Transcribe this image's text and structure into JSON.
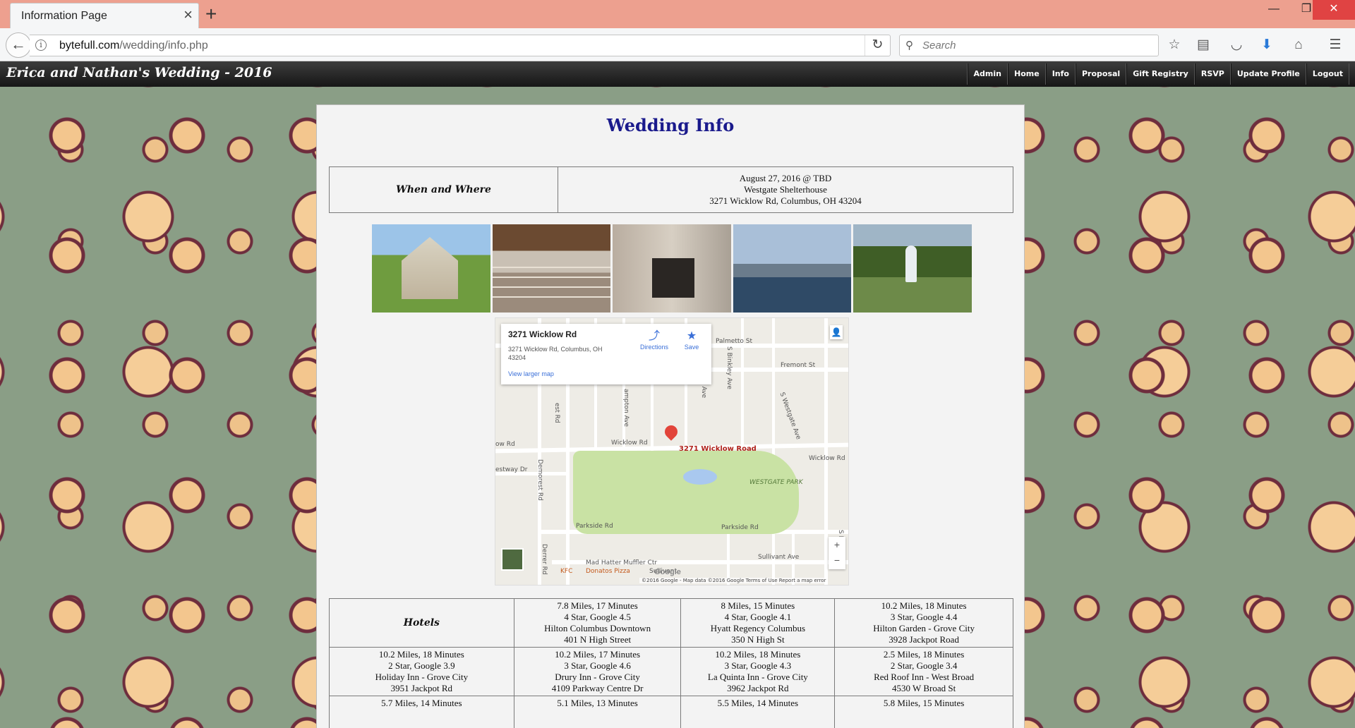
{
  "browser": {
    "tab_title": "Information Page",
    "url_host": "bytefull.com",
    "url_path": "/wedding/info.php",
    "search_placeholder": "Search"
  },
  "site": {
    "title": "Erica and Nathan's Wedding - 2016",
    "nav": [
      "Admin",
      "Home",
      "Info",
      "Proposal",
      "Gift Registry",
      "RSVP",
      "Update Profile",
      "Logout"
    ]
  },
  "main": {
    "page_title": "Wedding Info",
    "when_where": {
      "label": "When and Where",
      "date": "August 27, 2016 @ TBD",
      "venue": "Westgate Shelterhouse",
      "address": "3271 Wicklow Rd, Columbus, OH 43204"
    }
  },
  "map": {
    "card_title": "3271 Wicklow Rd",
    "card_address": "3271 Wicklow Rd, Columbus, OH 43204",
    "directions": "Directions",
    "save": "Save",
    "view_larger": "View larger map",
    "marker_label": "3271 Wicklow Road",
    "park_label": "WESTGATE PARK",
    "streets": {
      "palmetto": "Palmetto St",
      "fremont": "Fremont St",
      "wicklow": "Wicklow Rd",
      "wicklow_left": "ow Rd",
      "wicklow_right": "Wicklow Rd",
      "westway": "estway Dr",
      "demorest": "Demorest Rd",
      "parkside_left": "Parkside Rd",
      "parkside_right": "Parkside Rd",
      "sullivant": "Sullivant Ave",
      "westgate_ave": "S Westgate Ave",
      "binkley": "S Binkley Ave",
      "algonquin": "S Algonquin Ave",
      "hampton": "ampton Ave",
      "huron": "S Huron Ave",
      "rest_rd": "est Rd",
      "derrer": "Derrer Rd",
      "kfc": "KFC",
      "donatos": "Donatos Pizza",
      "mad_hatter": "Mad Hatter Muffler Ctr",
      "suli": "Sullivant"
    },
    "google": "Google",
    "footer": "©2016 Google - Map data ©2016 Google    Terms of Use    Report a map error"
  },
  "hotels": {
    "label": "Hotels",
    "rows": [
      [
        [
          "7.8 Miles, 17 Minutes",
          "4 Star, Google 4.5",
          "Hilton Columbus Downtown",
          "401 N High Street"
        ],
        [
          "8 Miles, 15 Minutes",
          "4 Star, Google 4.1",
          "Hyatt Regency Columbus",
          "350 N High St"
        ],
        [
          "10.2 Miles, 18 Minutes",
          "3 Star, Google 4.4",
          "Hilton Garden - Grove City",
          "3928 Jackpot Road"
        ]
      ],
      [
        [
          "10.2 Miles, 18 Minutes",
          "2 Star, Google 3.9",
          "Holiday Inn - Grove City",
          "3951 Jackpot Rd"
        ],
        [
          "10.2 Miles, 17 Minutes",
          "3 Star, Google 4.6",
          "Drury Inn - Grove City",
          "4109 Parkway Centre Dr"
        ],
        [
          "10.2 Miles, 18 Minutes",
          "3 Star, Google 4.3",
          "La Quinta Inn - Grove City",
          "3962 Jackpot Rd"
        ],
        [
          "2.5 Miles, 18 Minutes",
          "2 Star, Google 3.4",
          "Red Roof Inn - West Broad",
          "4530 W Broad St"
        ]
      ],
      [
        [
          "5.7 Miles, 14 Minutes"
        ],
        [
          "5.1 Miles, 13 Minutes"
        ],
        [
          "5.5 Miles, 14 Minutes"
        ],
        [
          "5.8 Miles, 15 Minutes"
        ]
      ]
    ]
  },
  "colors": {
    "title_blue": "#1a1a8c",
    "header_dark": "#161616",
    "browser_titlebar": "#eda08f"
  }
}
